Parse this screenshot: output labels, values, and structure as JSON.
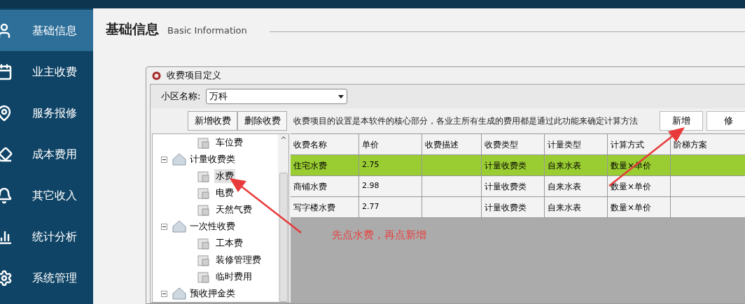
{
  "sidebar": {
    "items": [
      {
        "label": "基础信息",
        "selected": true
      },
      {
        "label": "业主收费",
        "selected": false
      },
      {
        "label": "服务报修",
        "selected": false
      },
      {
        "label": "成本费用",
        "selected": false
      },
      {
        "label": "其它收入",
        "selected": false
      },
      {
        "label": "统计分析",
        "selected": false
      },
      {
        "label": "系统管理",
        "selected": false
      }
    ]
  },
  "header": {
    "title": "基础信息",
    "subtitle": "Basic Information"
  },
  "dialog": {
    "title": "收费项目定义",
    "community": {
      "label": "小区名称:",
      "value": "万科"
    },
    "tree_buttons": [
      "新增收费",
      "删除收费"
    ],
    "description": "收费项目的设置是本软件的核心部分，各业主所有生成的费用都是通过此功能来确定计算方法",
    "action_buttons": [
      "新增",
      "修"
    ],
    "tree": {
      "orphan_children": [
        {
          "label": "车位费",
          "selected": false
        }
      ],
      "nodes": [
        {
          "label": "计量收费类",
          "expanded": true,
          "children": [
            {
              "label": "水费",
              "selected": true
            },
            {
              "label": "电费",
              "selected": false
            },
            {
              "label": "天然气费",
              "selected": false
            }
          ]
        },
        {
          "label": "一次性收费",
          "expanded": true,
          "children": [
            {
              "label": "工本费",
              "selected": false
            },
            {
              "label": "装修管理费",
              "selected": false
            },
            {
              "label": "临时费用",
              "selected": false
            }
          ]
        },
        {
          "label": "预收押金类",
          "expanded": true
        }
      ]
    },
    "table": {
      "columns": [
        "收费名称",
        "单价",
        "收费描述",
        "收费类型",
        "计量类型",
        "计算方式",
        "阶梯方案"
      ],
      "rows": [
        {
          "selected": true,
          "cells": [
            "住宅水费",
            "2.75",
            "",
            "计量收费类",
            "自来水表",
            "数量×单价",
            ""
          ]
        },
        {
          "selected": false,
          "cells": [
            "商铺水费",
            "2.98",
            "",
            "计量收费类",
            "自来水表",
            "数量×单价",
            ""
          ]
        },
        {
          "selected": false,
          "cells": [
            "写字楼水费",
            "2.77",
            "",
            "计量收费类",
            "自来水表",
            "数量×单价",
            ""
          ]
        }
      ]
    }
  },
  "annotation": {
    "text": "先点水费，再点新增"
  }
}
